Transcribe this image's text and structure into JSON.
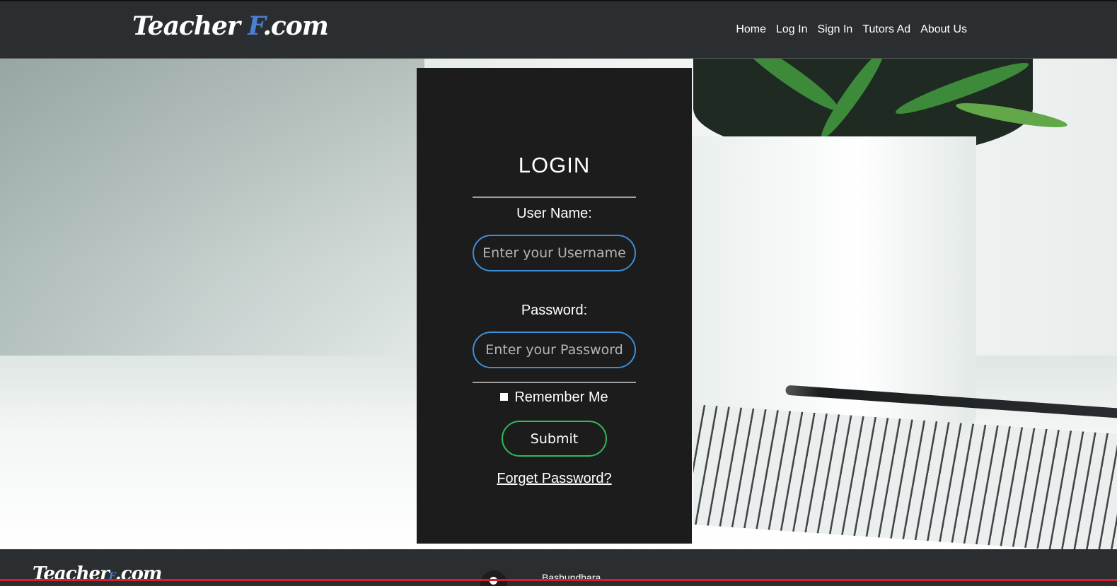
{
  "header": {
    "brand_main": "Teacher ",
    "brand_accent": "F",
    "brand_suffix": ".com",
    "nav": [
      "Home",
      "Log In",
      "Sign In",
      "Tutors Ad",
      "About Us"
    ]
  },
  "login": {
    "title": "LOGIN",
    "username_label": "User Name:",
    "username_placeholder": "Enter your Username",
    "password_label": "Password:",
    "password_placeholder": "Enter your Password",
    "remember_label": "Remember Me",
    "submit_label": "Submit",
    "forget_label": "Forget Password?"
  },
  "footer": {
    "brand_main": "Teacher",
    "brand_accent": "F",
    "brand_suffix": ".com",
    "address": "Bashundhara"
  },
  "colors": {
    "input_border": "#3e8ed8",
    "submit_border": "#2fbb5b",
    "brand_accent": "#4a7fd6",
    "footer_red": "#d61f26"
  }
}
